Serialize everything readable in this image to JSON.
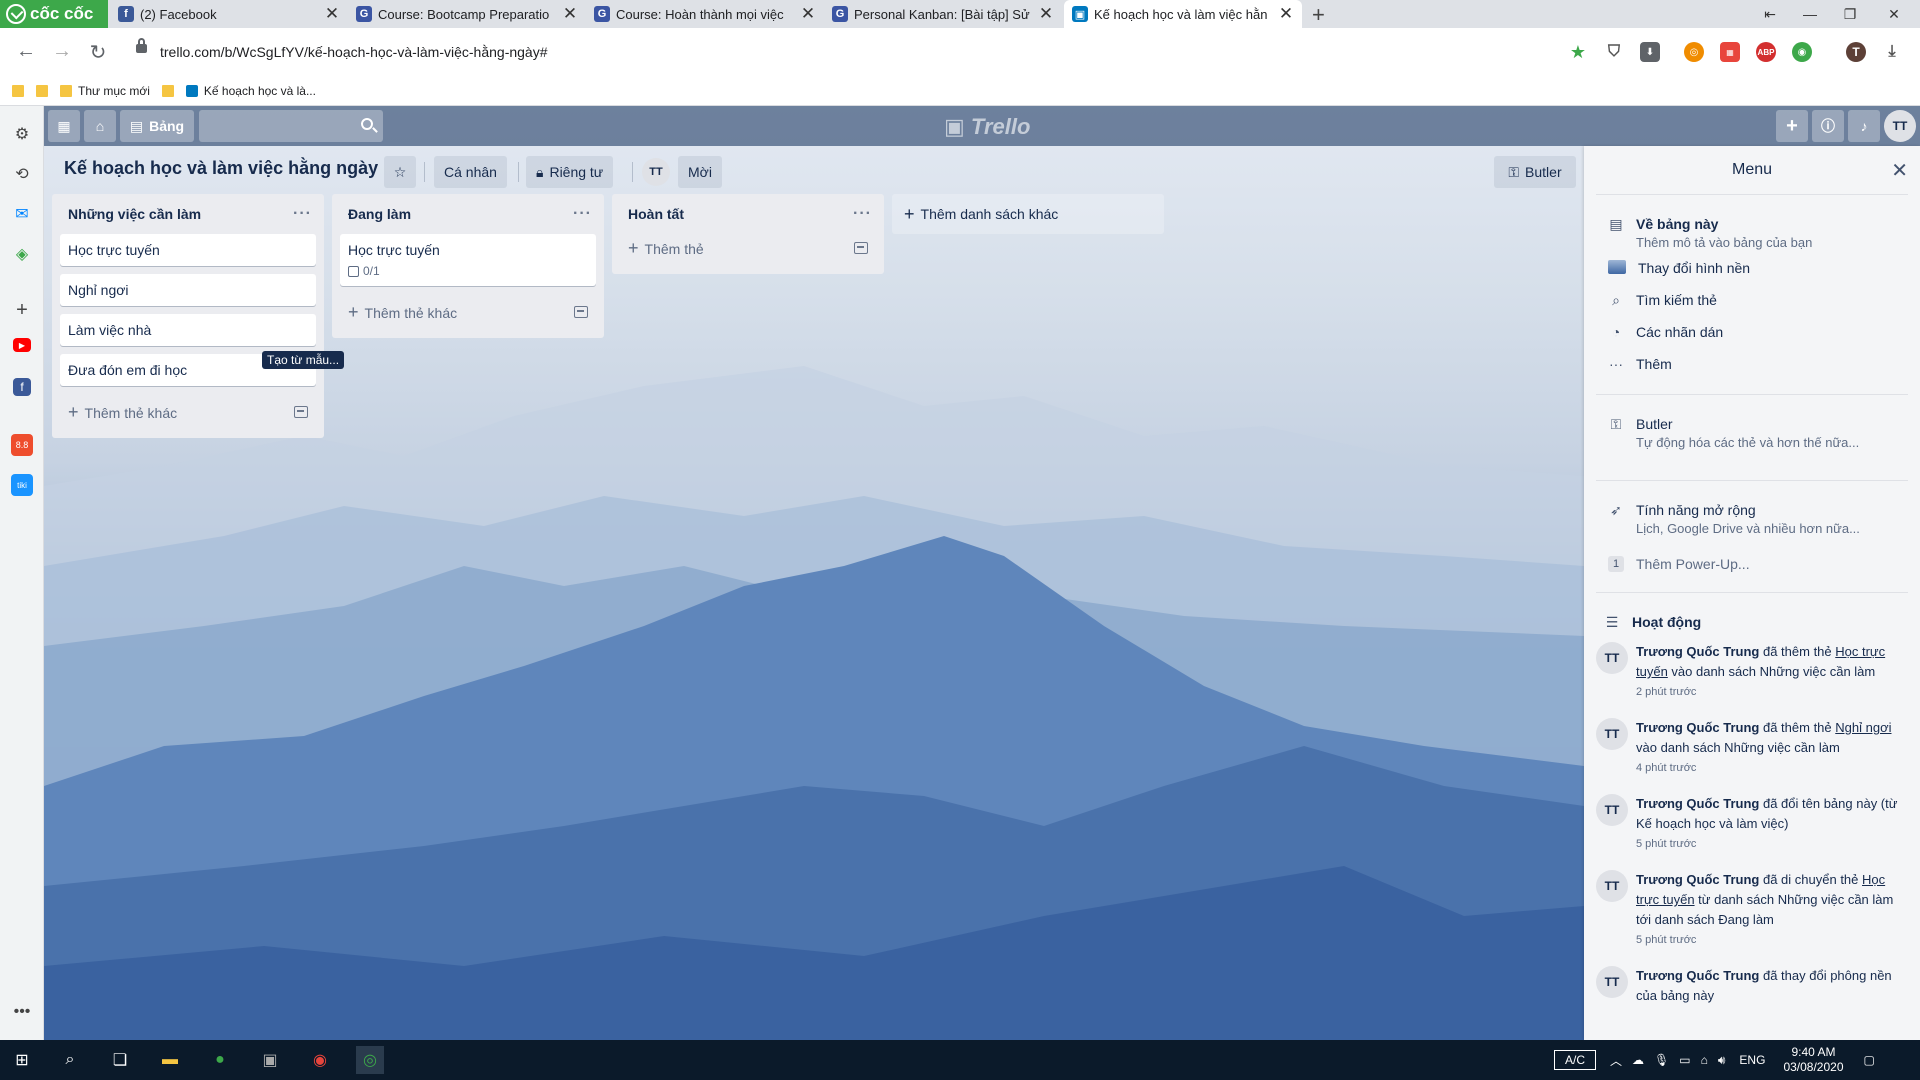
{
  "browser": {
    "brand": "cốc cốc",
    "tabs": [
      {
        "title": "(2) Facebook",
        "icon": "facebook-icon",
        "color": "#3b5998",
        "glyph": "f"
      },
      {
        "title": "Course: Bootcamp Preparatio",
        "icon": "course-icon",
        "color": "#3b55a3",
        "glyph": "G"
      },
      {
        "title": "Course: Hoàn thành mọi việc",
        "icon": "course-icon",
        "color": "#3b55a3",
        "glyph": "G"
      },
      {
        "title": "Personal Kanban: [Bài tập] Sử",
        "icon": "course-icon",
        "color": "#3b55a3",
        "glyph": "G"
      },
      {
        "title": "Kế hoạch học và làm việc hằn",
        "icon": "trello-icon",
        "color": "#0079bf",
        "glyph": "▣"
      }
    ],
    "url": "trello.com/b/WcSgLfYV/kế-hoạch-học-và-làm-việc-hằng-ngày#",
    "bookmarks": [
      {
        "label": ""
      },
      {
        "label": ""
      },
      {
        "label": "Thư mục mới"
      },
      {
        "label": ""
      },
      {
        "label": "Kế hoạch học và là..."
      }
    ],
    "profile_initial": "T"
  },
  "trello": {
    "nav": {
      "board_label": "Bảng",
      "logo": "Trello",
      "user_initials": "TT"
    },
    "board": {
      "title": "Kế hoạch học và làm việc hằng ngày",
      "team": "Cá nhân",
      "visibility": "Riêng tư",
      "member_initials": "TT",
      "invite": "Mời",
      "butler": "Butler"
    },
    "lists": [
      {
        "name": "Những việc cần làm",
        "cards": [
          "Học trực tuyến",
          "Nghỉ ngơi",
          "Làm việc nhà",
          "Đưa đón em đi học"
        ],
        "add_label": "Thêm thẻ khác"
      },
      {
        "name": "Đang làm",
        "cards": [
          "Học trực tuyến"
        ],
        "checklist": "0/1",
        "add_label": "Thêm thẻ khác"
      },
      {
        "name": "Hoàn tất",
        "cards": [],
        "add_label": "Thêm thẻ"
      }
    ],
    "add_list_label": "Thêm danh sách khác",
    "tooltip": "Tạo từ mẫu...",
    "menu": {
      "title": "Menu",
      "about": {
        "label": "Về bảng này",
        "sub": "Thêm mô tả vào bảng của bạn"
      },
      "background": "Thay đổi hình nền",
      "search": "Tìm kiếm thẻ",
      "stickers": "Các nhãn dán",
      "more": "Thêm",
      "butler": {
        "label": "Butler",
        "sub": "Tự động hóa các thẻ và hơn thế nữa..."
      },
      "powerups": {
        "label": "Tính năng mở rộng",
        "sub": "Lịch, Google Drive và nhiều hơn nữa..."
      },
      "add_powerup": {
        "count": "1",
        "label": "Thêm Power-Up..."
      },
      "activity_title": "Hoạt động",
      "activities": [
        {
          "user": "Trương Quốc Trung",
          "pre": " đã thêm thẻ ",
          "link": "Học trực tuyến",
          "post": " vào danh sách Những việc cần làm",
          "time": "2 phút trước"
        },
        {
          "user": "Trương Quốc Trung",
          "pre": " đã thêm thẻ ",
          "link": "Nghỉ ngơi",
          "post": " vào danh sách Những việc cần làm",
          "time": "4 phút trước"
        },
        {
          "user": "Trương Quốc Trung",
          "pre": " đã đổi tên bảng này (từ Kế hoạch học và làm việc)",
          "link": "",
          "post": "",
          "time": "5 phút trước"
        },
        {
          "user": "Trương Quốc Trung",
          "pre": " đã di chuyển thẻ ",
          "link": "Học trực tuyến",
          "post": " từ danh sách Những việc cần làm tới danh sách Đang làm",
          "time": "5 phút trước"
        },
        {
          "user": "Trương Quốc Trung",
          "pre": " đã thay đổi phông nền của bảng này",
          "link": "",
          "post": "",
          "time": ""
        }
      ]
    }
  },
  "taskbar": {
    "keyboard_mode": "A/C",
    "language": "ENG",
    "time": "9:40 AM",
    "date": "03/08/2020"
  }
}
